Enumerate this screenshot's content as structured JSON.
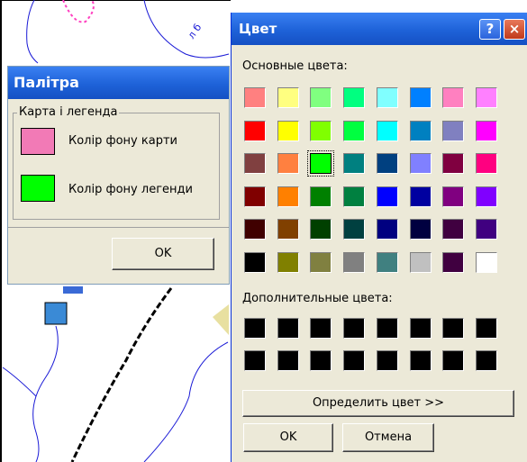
{
  "palette": {
    "title": "Палітра",
    "group_label": "Карта і легенда",
    "map_bg_label": "Колір фону карти",
    "map_bg_color": "#f27ab6",
    "legend_bg_label": "Колір фону легенди",
    "legend_bg_color": "#00ff00",
    "ok_label": "OK"
  },
  "map": {
    "fragment_text": "л б",
    "river_color": "#1a1ad6",
    "road_color": "#000000",
    "marker_color": "#3a8ad6"
  },
  "dialog": {
    "title": "Цвет",
    "help_icon": "?",
    "close_icon": "×",
    "basic_colors_label": "Основные цвета:",
    "custom_colors_label": "Дополнительные цвета:",
    "define_button_label": "Определить цвет >>",
    "ok_label": "OK",
    "cancel_label": "Отмена",
    "selected_basic_index": 18,
    "basic_colors": [
      "#ff8080",
      "#ffff80",
      "#80ff80",
      "#00ff80",
      "#80ffff",
      "#0080ff",
      "#ff80c0",
      "#ff80ff",
      "#ff0000",
      "#ffff00",
      "#80ff00",
      "#00ff40",
      "#00ffff",
      "#0080c0",
      "#8080c0",
      "#ff00ff",
      "#804040",
      "#ff8040",
      "#00ff00",
      "#008080",
      "#004080",
      "#8080ff",
      "#800040",
      "#ff0080",
      "#800000",
      "#ff8000",
      "#008000",
      "#008040",
      "#0000ff",
      "#0000a0",
      "#800080",
      "#8000ff",
      "#400000",
      "#804000",
      "#004000",
      "#004040",
      "#000080",
      "#000040",
      "#400040",
      "#400080",
      "#000000",
      "#808000",
      "#808040",
      "#808080",
      "#408080",
      "#c0c0c0",
      "#400040",
      "#ffffff"
    ],
    "custom_colors": [
      "#000000",
      "#000000",
      "#000000",
      "#000000",
      "#000000",
      "#000000",
      "#000000",
      "#000000",
      "#000000",
      "#000000",
      "#000000",
      "#000000",
      "#000000",
      "#000000",
      "#000000",
      "#000000"
    ]
  }
}
